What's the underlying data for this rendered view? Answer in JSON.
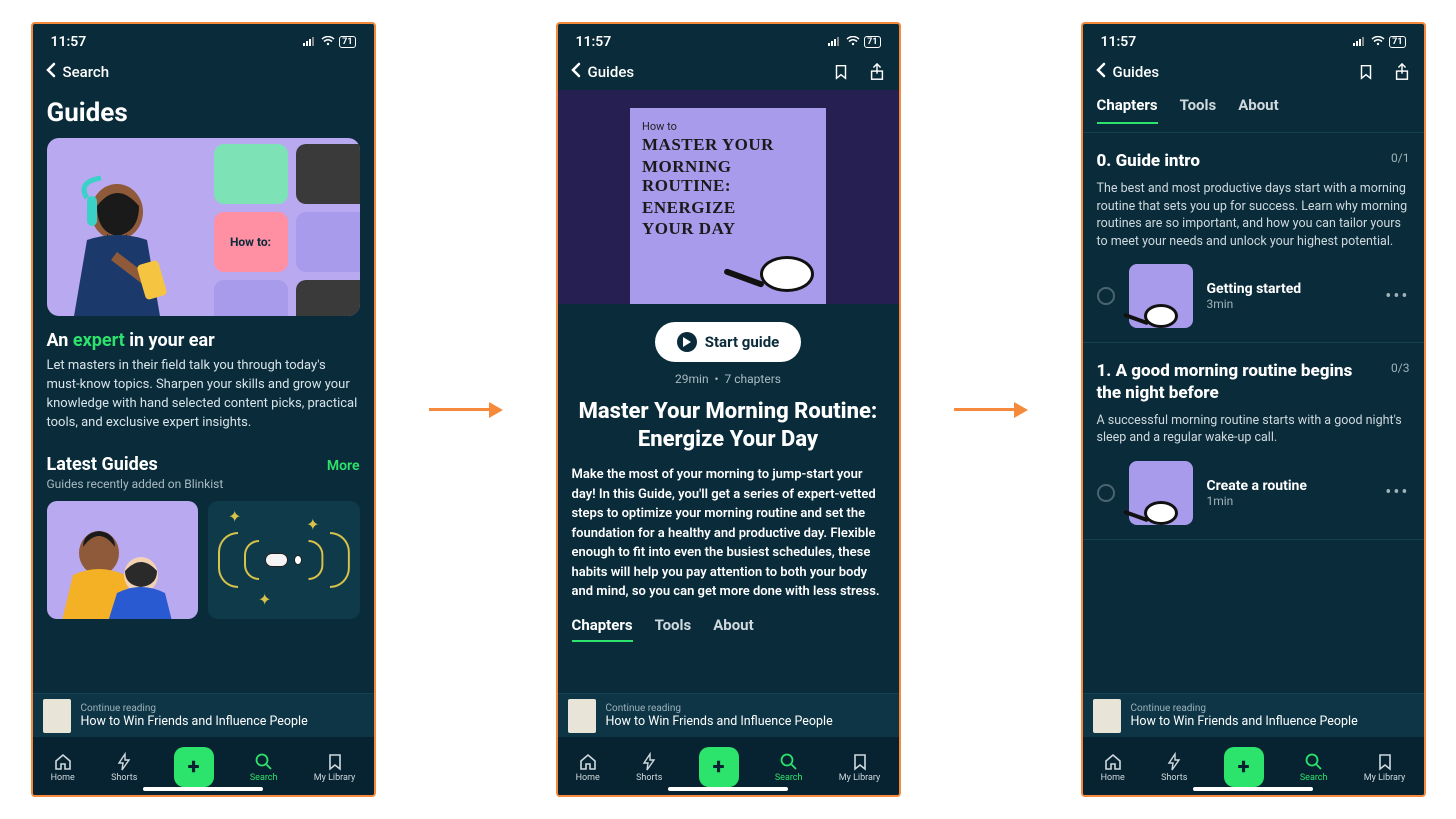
{
  "status": {
    "time": "11:57",
    "battery": "71"
  },
  "nav": {
    "screen1_back": "Search",
    "screen2_back": "Guides",
    "screen3_back": "Guides"
  },
  "screen1": {
    "title": "Guides",
    "tagline_prefix": "An ",
    "tagline_accent": "expert",
    "tagline_suffix": " in your ear",
    "description": "Let masters in their field talk you through today's must-know topics. Sharpen your skills and grow your knowledge with hand selected content picks, practical tools, and exclusive expert insights.",
    "section_title": "Latest Guides",
    "section_more": "More",
    "section_sub": "Guides recently added on Blinkist",
    "hero_howto": "How to:"
  },
  "screen2": {
    "cover_small": "How to",
    "cover_line1": "MASTER YOUR",
    "cover_line2": "MORNING ROUTINE:",
    "cover_line3": "ENERGIZE",
    "cover_line4": "YOUR DAY",
    "start_label": "Start guide",
    "meta_duration": "29min",
    "meta_sep": "•",
    "meta_chapters": "7 chapters",
    "title": "Master Your Morning Routine: Energize Your Day",
    "description": "Make the most of your morning to jump-start your day! In this Guide, you'll get a series of expert-vetted steps to optimize your morning routine and set the foundation for a healthy and productive day. Flexible enough to fit into even the busiest schedules, these habits will help you pay attention to both your body and mind, so you can get more done with less stress.",
    "tabs": {
      "chapters": "Chapters",
      "tools": "Tools",
      "about": "About"
    }
  },
  "screen3": {
    "tabs": {
      "chapters": "Chapters",
      "tools": "Tools",
      "about": "About"
    },
    "chapters": [
      {
        "title": "0. Guide intro",
        "count": "0/1",
        "description": "The best and most productive days start with a morning routine that sets you up for success. Learn why morning routines are so important, and how you can tailor yours to meet your needs and unlock your highest potential.",
        "lesson": {
          "title": "Getting started",
          "duration": "3min"
        }
      },
      {
        "title": "1. A good morning routine begins the night before",
        "count": "0/3",
        "description": "A successful morning routine starts with a good night's sleep and a regular wake-up call.",
        "lesson": {
          "title": "Create a routine",
          "duration": "1min"
        }
      }
    ]
  },
  "continue": {
    "label": "Continue reading",
    "book": "How to Win Friends and Influence People"
  },
  "tabbar": {
    "home": "Home",
    "shorts": "Shorts",
    "search": "Search",
    "library": "My Library"
  }
}
